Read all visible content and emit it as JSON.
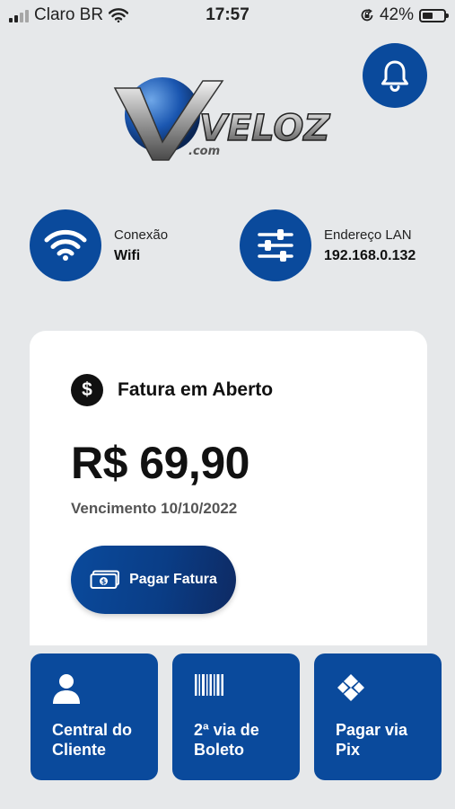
{
  "status_bar": {
    "carrier": "Claro BR",
    "time": "17:57",
    "battery": "42%",
    "battery_level": 0.42
  },
  "header": {
    "logo_text": "VELOZ",
    "logo_sub": ".com",
    "notification_icon": "bell-icon"
  },
  "connection": {
    "label": "Conexão",
    "value": "Wifi",
    "icon": "wifi-icon"
  },
  "lan": {
    "label": "Endereço LAN",
    "value": "192.168.0.132",
    "icon": "sliders-icon"
  },
  "invoice": {
    "title": "Fatura em Aberto",
    "currency_symbol": "$",
    "amount": "R$ 69,90",
    "due": "Vencimento 10/10/2022",
    "pay_button": "Pagar Fatura"
  },
  "tiles": [
    {
      "label": "Central do Cliente",
      "icon": "user-icon"
    },
    {
      "label": "2ª via de Boleto",
      "icon": "barcode-icon"
    },
    {
      "label": "Pagar via Pix",
      "icon": "pix-icon"
    }
  ],
  "colors": {
    "brand_blue": "#0a4a9c",
    "background": "#e6e8ea"
  }
}
